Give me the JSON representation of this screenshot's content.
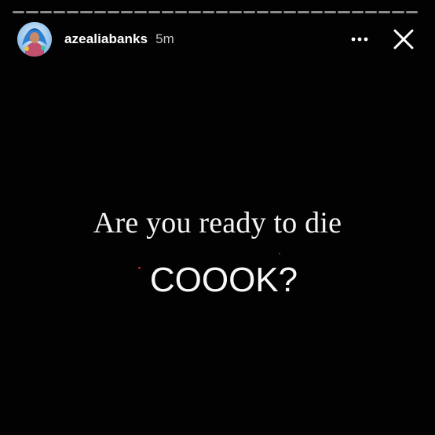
{
  "story": {
    "progress_segments": 30,
    "header": {
      "username": "azealiabanks",
      "timestamp": "5m",
      "more_icon": "more-horizontal-icon",
      "close_icon": "close-icon"
    },
    "text": {
      "line1": "Are you ready to die",
      "line2": "COOOK?"
    },
    "colors": {
      "background": "#020202",
      "text": "#ffffff",
      "speck_red": "#e0303a"
    }
  }
}
